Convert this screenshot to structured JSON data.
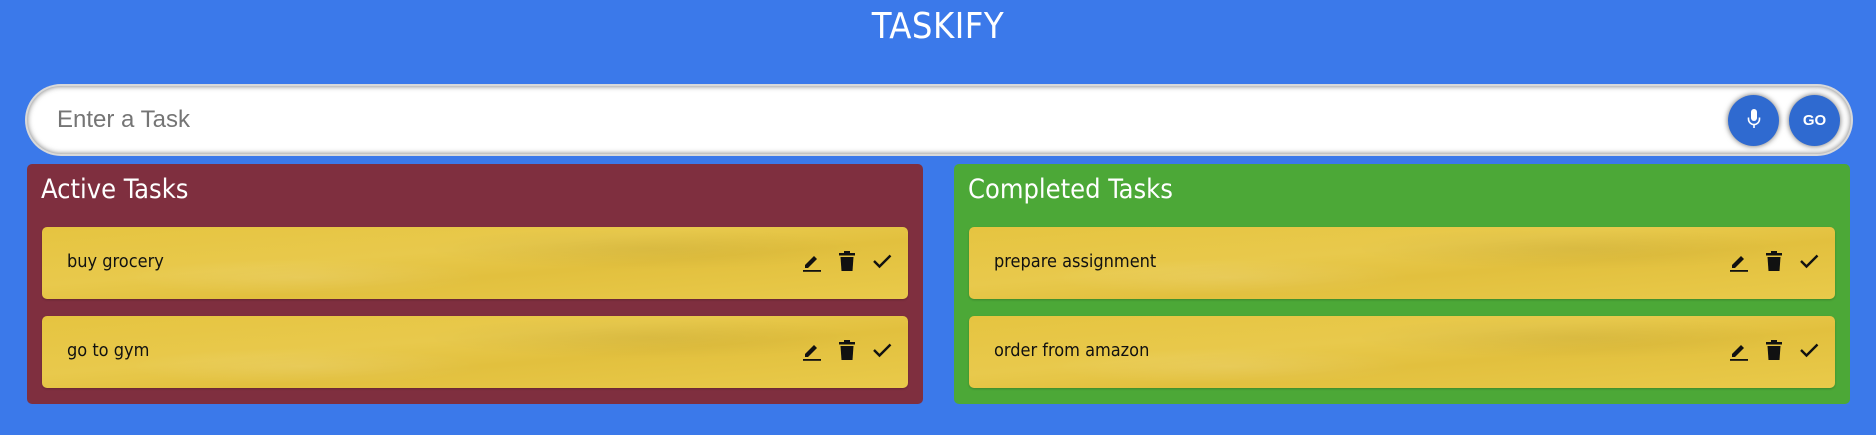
{
  "app": {
    "title": "TASKIFY"
  },
  "input": {
    "placeholder": "Enter a Task",
    "value": ""
  },
  "buttons": {
    "mic_icon": "microphone-icon",
    "go_label": "GO"
  },
  "active": {
    "heading": "Active Tasks",
    "tasks": [
      {
        "text": "buy grocery"
      },
      {
        "text": "go to gym"
      }
    ]
  },
  "completed": {
    "heading": "Completed Tasks",
    "tasks": [
      {
        "text": "prepare assignment"
      },
      {
        "text": "order from amazon"
      }
    ]
  },
  "icons": {
    "edit": "pencil-icon",
    "delete": "trash-icon",
    "done": "check-icon"
  },
  "colors": {
    "background": "#3b79ea",
    "active_panel": "#7f2f3f",
    "completed_panel": "#4ca837",
    "task_card": "#e6c440",
    "button": "#2f6ad0"
  }
}
